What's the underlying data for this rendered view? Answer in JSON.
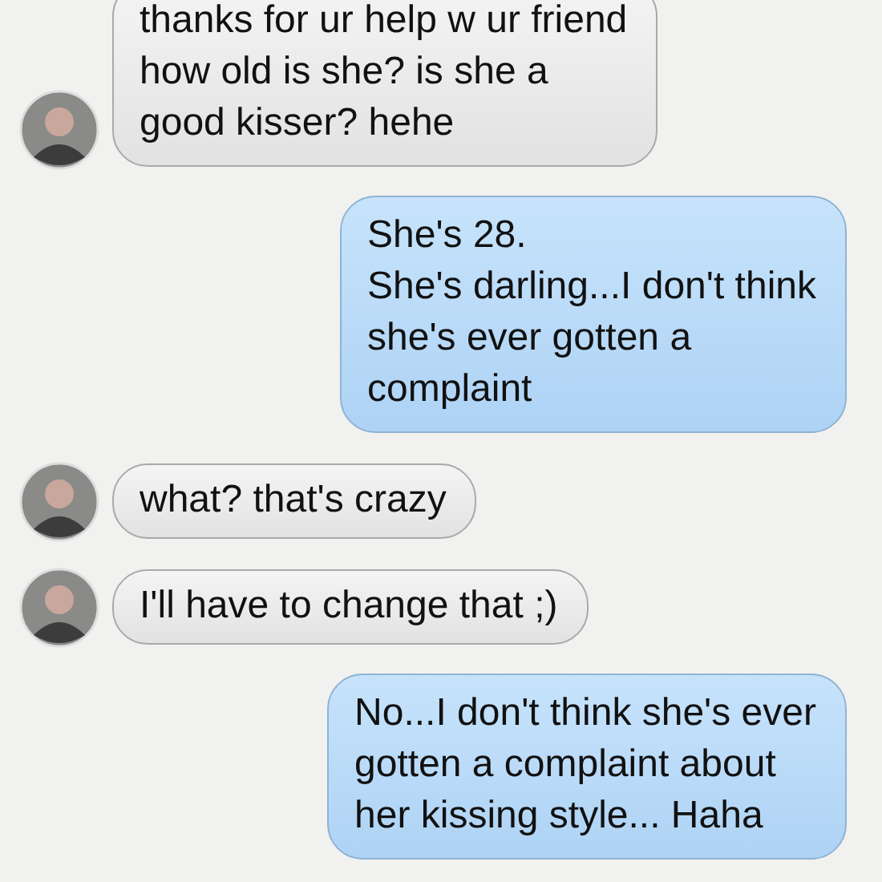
{
  "messages": [
    {
      "kind": "incoming",
      "text": "thanks for ur help w ur friend\nhow old is she? is she a\ngood kisser? hehe",
      "avatar": true
    },
    {
      "kind": "outgoing",
      "text": "She's 28.\nShe's darling...I don't think\nshe's ever gotten a\ncomplaint",
      "avatar": false
    },
    {
      "kind": "incoming",
      "text": "what? that's crazy",
      "avatar": true
    },
    {
      "kind": "incoming",
      "text": "I'll have to change that ;)",
      "avatar": true
    },
    {
      "kind": "outgoing",
      "text": "No...I don't think she's ever\ngotten a complaint about\nher kissing style... Haha",
      "avatar": false
    }
  ]
}
